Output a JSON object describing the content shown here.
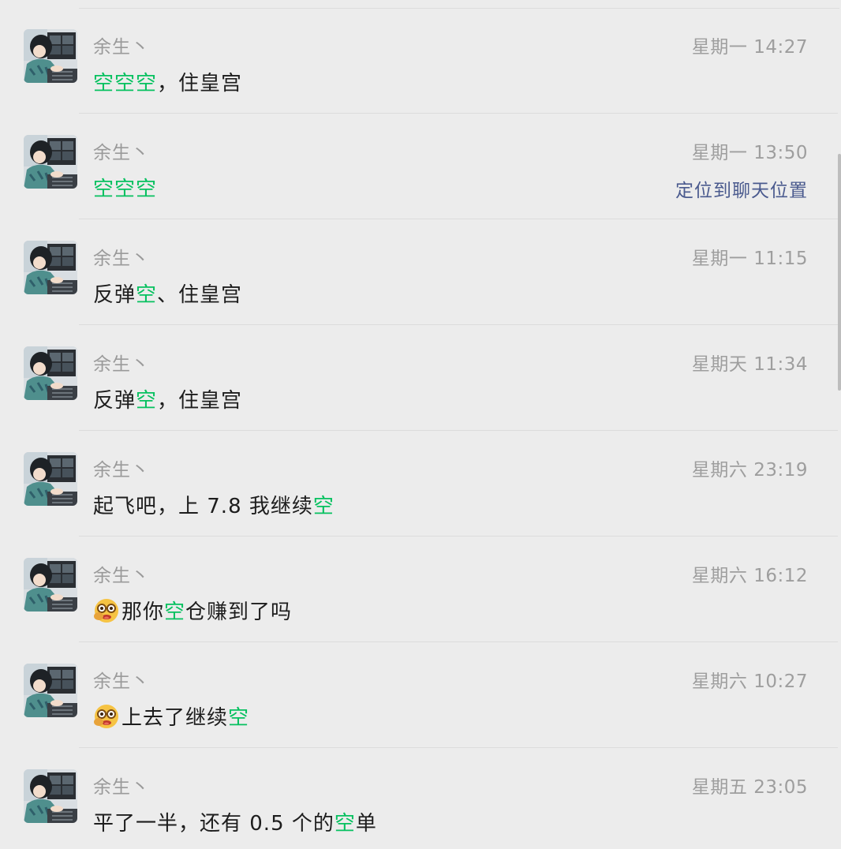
{
  "colors": {
    "background": "#ececec",
    "highlight": "#07c160",
    "link": "#4a5a8e",
    "meta_text": "#9e9e9e",
    "message_text": "#1d1d1d"
  },
  "results": [
    {
      "sender": "余生丶",
      "time": "星期一 14:27",
      "message": {
        "parts": [
          {
            "text": "空空空",
            "highlight": true
          },
          {
            "text": "，住皇宫",
            "highlight": false
          }
        ]
      },
      "emoji": null,
      "locate_label": null
    },
    {
      "sender": "余生丶",
      "time": "星期一 13:50",
      "message": {
        "parts": [
          {
            "text": "空空空",
            "highlight": true
          }
        ]
      },
      "emoji": null,
      "locate_label": "定位到聊天位置"
    },
    {
      "sender": "余生丶",
      "time": "星期一 11:15",
      "message": {
        "parts": [
          {
            "text": "反弹",
            "highlight": false
          },
          {
            "text": "空",
            "highlight": true
          },
          {
            "text": "、住皇宫",
            "highlight": false
          }
        ]
      },
      "emoji": null,
      "locate_label": null
    },
    {
      "sender": "余生丶",
      "time": "星期天 11:34",
      "message": {
        "parts": [
          {
            "text": "反弹",
            "highlight": false
          },
          {
            "text": "空",
            "highlight": true
          },
          {
            "text": "，住皇宫",
            "highlight": false
          }
        ]
      },
      "emoji": null,
      "locate_label": null
    },
    {
      "sender": "余生丶",
      "time": "星期六 23:19",
      "message": {
        "parts": [
          {
            "text": "起飞吧，上 7.8 我继续",
            "highlight": false
          },
          {
            "text": "空",
            "highlight": true
          }
        ]
      },
      "emoji": null,
      "locate_label": null
    },
    {
      "sender": "余生丶",
      "time": "星期六 16:12",
      "message": {
        "parts": [
          {
            "text": "那你",
            "highlight": false
          },
          {
            "text": "空",
            "highlight": true
          },
          {
            "text": "仓赚到了吗",
            "highlight": false
          }
        ]
      },
      "emoji": "nerd-face-emoji",
      "locate_label": null
    },
    {
      "sender": "余生丶",
      "time": "星期六 10:27",
      "message": {
        "parts": [
          {
            "text": "上去了继续",
            "highlight": false
          },
          {
            "text": "空",
            "highlight": true
          }
        ]
      },
      "emoji": "nerd-face-emoji",
      "locate_label": null
    },
    {
      "sender": "余生丶",
      "time": "星期五 23:05",
      "message": {
        "parts": [
          {
            "text": "平了一半，还有 0.5 个的",
            "highlight": false
          },
          {
            "text": "空",
            "highlight": true
          },
          {
            "text": "单",
            "highlight": false
          }
        ]
      },
      "emoji": null,
      "locate_label": null
    }
  ]
}
